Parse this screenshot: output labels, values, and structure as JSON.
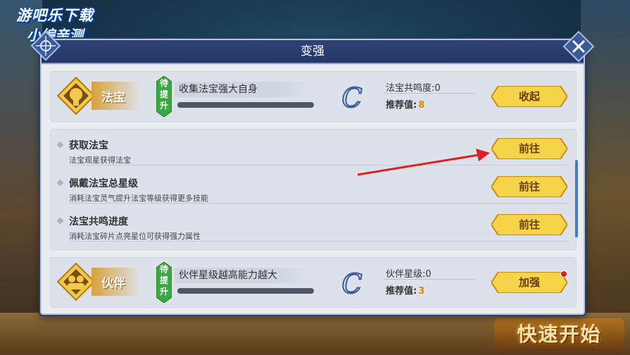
{
  "watermark": {
    "line1": "游吧乐下载",
    "line2": "小编亲测"
  },
  "background": {
    "quick_start": "快速开始"
  },
  "modal": {
    "title": "变强",
    "fabao_card": {
      "label": "法宝",
      "pending": [
        "待",
        "提",
        "升"
      ],
      "description": "收集法宝强大自身",
      "progress": 0,
      "grade": "C",
      "stat_line": "法宝共鸣度:0",
      "recommend_label": "推荐值:",
      "recommend_value": "8",
      "button": "收起"
    },
    "ways": [
      {
        "title": "获取法宝",
        "desc": "法宝观星获得法宝",
        "button": "前往"
      },
      {
        "title": "佩戴法宝总星级",
        "desc": "消耗法宝灵气提升法宝等级获得更多技能",
        "button": "前往"
      },
      {
        "title": "法宝共鸣进度",
        "desc": "消耗法宝碎片点亮星位可获得强力属性",
        "button": "前往"
      }
    ],
    "partner_card": {
      "label": "伙伴",
      "pending": [
        "待",
        "提",
        "升"
      ],
      "description": "伙伴星级越高能力越大",
      "progress": 0,
      "grade": "C",
      "stat_line": "伙伴星级:0",
      "recommend_label": "推荐值:",
      "recommend_value": "3",
      "button": "加强"
    }
  },
  "colors": {
    "header": "#2e4377",
    "gold": "#f5d44a",
    "accent": "#d88a00",
    "pending_green": "#3aa840",
    "arrow": "#e02020"
  },
  "icons": {
    "close": "close-x-icon",
    "fabao": "fabao-emblem-icon",
    "partner": "partner-emblem-icon",
    "grade": "grade-c-icon"
  }
}
